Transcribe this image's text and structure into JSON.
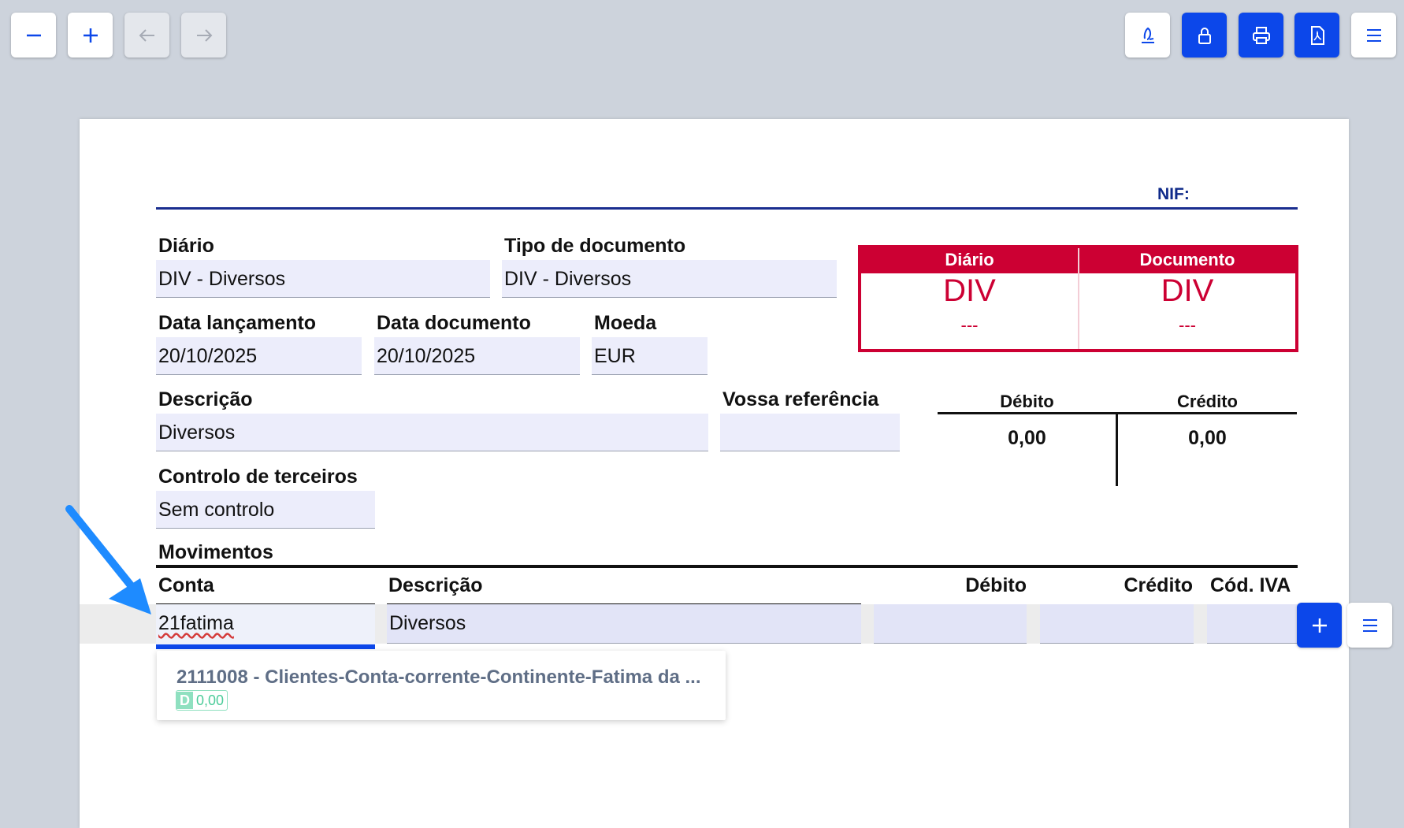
{
  "toolbar": {
    "left_buttons": [
      "zoom-out",
      "zoom-in",
      "back",
      "forward"
    ],
    "right_buttons": [
      "sign",
      "lock",
      "print",
      "pdf",
      "menu"
    ],
    "accent": "#0c47ea"
  },
  "header": {
    "nif_label": "NIF:"
  },
  "form": {
    "diario_label": "Diário",
    "diario_value": "DIV - Diversos",
    "tipo_label": "Tipo de documento",
    "tipo_value": "DIV - Diversos",
    "data_lanc_label": "Data lançamento",
    "data_lanc_value": "20/10/2025",
    "data_doc_label": "Data documento",
    "data_doc_value": "20/10/2025",
    "moeda_label": "Moeda",
    "moeda_value": "EUR",
    "descricao_label": "Descrição",
    "descricao_value": "Diversos",
    "vossa_ref_label": "Vossa referência",
    "vossa_ref_value": "",
    "controlo_label": "Controlo de terceiros",
    "controlo_value": "Sem controlo"
  },
  "doc_box": {
    "color": "#cc0033",
    "col1_header": "Diário",
    "col1_value": "DIV",
    "col1_sub": "---",
    "col2_header": "Documento",
    "col2_value": "DIV",
    "col2_sub": "---"
  },
  "totals": {
    "debito_label": "Débito",
    "debito_value": "0,00",
    "credito_label": "Crédito",
    "credito_value": "0,00"
  },
  "movimentos": {
    "title": "Movimentos",
    "headers": {
      "conta": "Conta",
      "descricao": "Descrição",
      "debito": "Débito",
      "credito": "Crédito",
      "cod_iva": "Cód. IVA"
    },
    "row": {
      "conta": "21fatima",
      "descricao": "Diversos",
      "debito": "",
      "credito": "",
      "cod_iva": ""
    }
  },
  "autocomplete": {
    "item_text": "2111008 - Clientes-Conta-corrente-Continente-Fatima da ...",
    "badge_letter": "D",
    "badge_value": "0,00"
  }
}
